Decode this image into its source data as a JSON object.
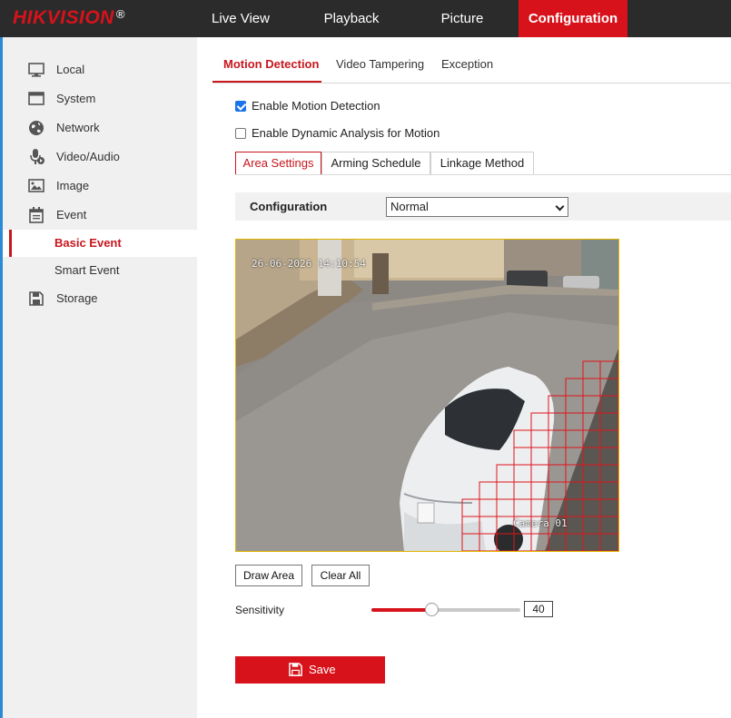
{
  "brand": {
    "logo": "HIKVISION",
    "reg": "®"
  },
  "nav": {
    "items": [
      {
        "label": "Live View"
      },
      {
        "label": "Playback"
      },
      {
        "label": "Picture"
      },
      {
        "label": "Configuration",
        "active": true
      }
    ]
  },
  "sidebar": {
    "items": [
      {
        "label": "Local",
        "icon": "monitor-icon"
      },
      {
        "label": "System",
        "icon": "system-window-icon"
      },
      {
        "label": "Network",
        "icon": "globe-icon"
      },
      {
        "label": "Video/Audio",
        "icon": "microphone-icon"
      },
      {
        "label": "Image",
        "icon": "image-icon"
      },
      {
        "label": "Event",
        "icon": "calendar-icon"
      },
      {
        "label": "Storage",
        "icon": "save-disk-icon"
      }
    ],
    "sub_items": [
      {
        "label": "Basic Event",
        "active": true
      },
      {
        "label": "Smart Event"
      }
    ]
  },
  "tabs": [
    {
      "label": "Motion Detection",
      "active": true
    },
    {
      "label": "Video Tampering"
    },
    {
      "label": "Exception"
    }
  ],
  "options": {
    "enable_motion": {
      "label": "Enable Motion Detection",
      "checked": true
    },
    "enable_dynamic": {
      "label": "Enable Dynamic Analysis for Motion",
      "checked": false
    }
  },
  "subtabs": [
    {
      "label": "Area Settings",
      "active": true
    },
    {
      "label": "Arming Schedule"
    },
    {
      "label": "Linkage Method"
    }
  ],
  "configuration": {
    "label": "Configuration",
    "value": "Normal"
  },
  "video": {
    "timestamp": "26-06-2026 14:10:54",
    "camera_label": "Camera 01"
  },
  "actions": {
    "draw_area": "Draw Area",
    "clear_all": "Clear All"
  },
  "sensitivity": {
    "label": "Sensitivity",
    "value": "40",
    "level": 0.4
  },
  "save": {
    "label": "Save"
  },
  "colors": {
    "accent": "#d8121a",
    "topbar": "#2b2b2b",
    "sidebar": "#f0f0f0",
    "grid": "#e0141a",
    "video_border": "#e0b400"
  }
}
